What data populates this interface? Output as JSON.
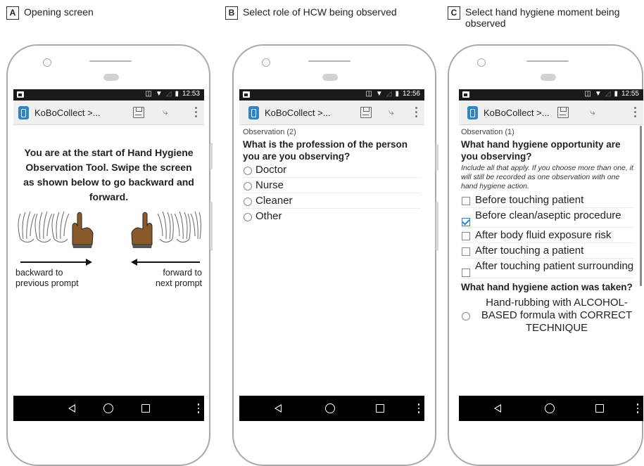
{
  "panels": [
    {
      "letter": "A",
      "caption": "Opening screen"
    },
    {
      "letter": "B",
      "caption": "Select role of HCW being observed"
    },
    {
      "letter": "C",
      "caption": "Select hand hygiene moment being observed"
    }
  ],
  "status": {
    "time_a": "12:53",
    "time_b": "12:56",
    "time_c": "12:55"
  },
  "app_title": "KoBoCollect >...",
  "screen_a": {
    "intro": "You are at the start of Hand Hygiene Observation Tool. Swipe the screen as shown below to go backward and forward.",
    "backward_label": "backward to previous prompt",
    "forward_label": "forward to next prompt"
  },
  "screen_b": {
    "observation": "Observation (2)",
    "question": "What is the profession of the person you are you observing?",
    "options": [
      "Doctor",
      "Nurse",
      "Cleaner",
      "Other"
    ]
  },
  "screen_c": {
    "observation": "Observation (1)",
    "question": "What hand hygiene opportunity are you observing?",
    "hint": "Include all that apply. If you choose more than one, it will still be recorded as one observation with one hand hygiene action.",
    "options": [
      {
        "label": "Before touching patient",
        "checked": false
      },
      {
        "label": "Before clean/aseptic procedure",
        "checked": true
      },
      {
        "label": "After body fluid exposure risk",
        "checked": false
      },
      {
        "label": "After touching a patient",
        "checked": false
      },
      {
        "label": "After touching patient surrounding",
        "checked": false
      }
    ],
    "question2": "What hand hygiene action was taken?",
    "option2": "Hand-rubbing with ALCOHOL-BASED formula with CORRECT TECHNIQUE"
  },
  "colors": {
    "accent": "#2e84c6",
    "hand": "#8b5a2b"
  },
  "icons": [
    "save-icon",
    "navigate-icon",
    "overflow-menu-icon",
    "back-icon",
    "home-icon",
    "recents-icon"
  ]
}
